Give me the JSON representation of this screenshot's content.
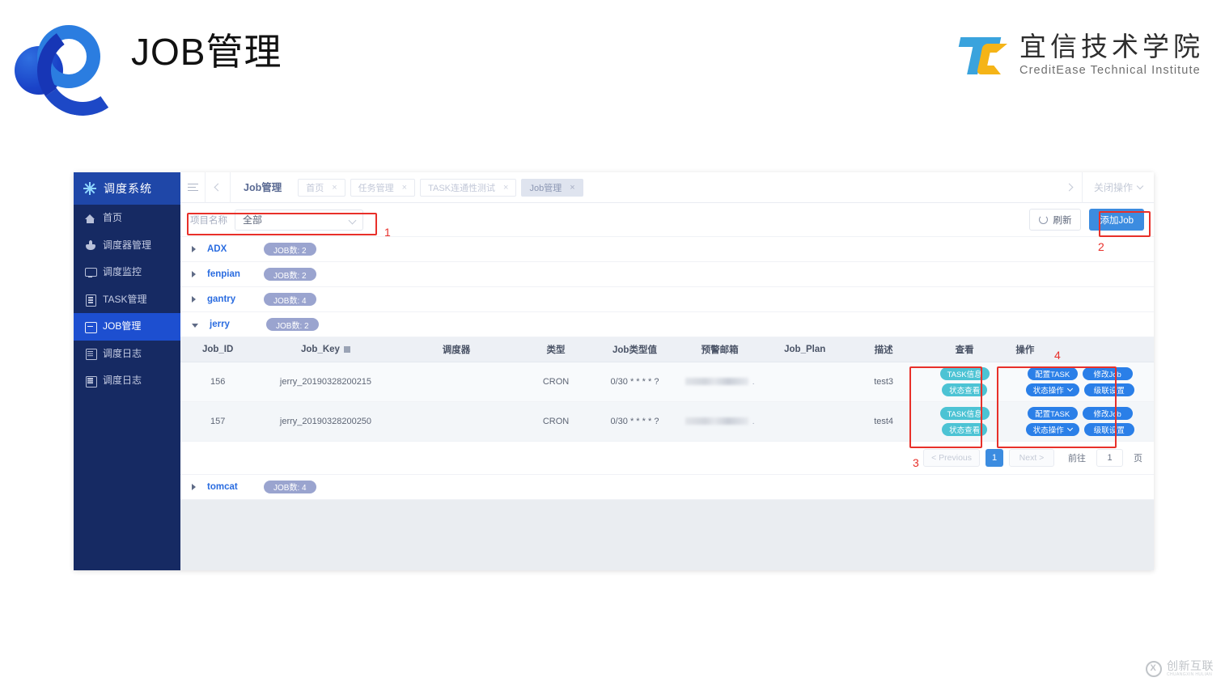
{
  "header": {
    "title": "JOB管理",
    "logo_icon": "overlapping-circles-logo",
    "corp_cn": "宜信技术学院",
    "corp_en": "CreditEase Technical Institute",
    "corp_logo_icon": "tc-monogram-logo"
  },
  "sidebar": {
    "brand": "调度系统",
    "brand_icon": "sun-burst-icon",
    "items": [
      {
        "label": "首页",
        "icon": "home-icon",
        "active": false
      },
      {
        "label": "调度器管理",
        "icon": "scheduler-icon",
        "active": false
      },
      {
        "label": "调度监控",
        "icon": "monitor-icon",
        "active": false
      },
      {
        "label": "TASK管理",
        "icon": "document-icon",
        "active": false
      },
      {
        "label": "JOB管理",
        "icon": "job-grid-icon",
        "active": true
      },
      {
        "label": "调度日志",
        "icon": "log-icon",
        "active": false
      },
      {
        "label": "调度日志",
        "icon": "log-icon",
        "active": false
      }
    ]
  },
  "tabbar": {
    "menu_icon": "hamburger-icon",
    "scroll_left_icon": "chevron-left-icon",
    "scroll_right_icon": "chevron-right-icon",
    "current_title": "Job管理",
    "tabs": [
      {
        "label": "首页",
        "active": false,
        "close": "×"
      },
      {
        "label": "任务管理",
        "active": false,
        "close": "×"
      },
      {
        "label": "TASK连通性测试",
        "active": false,
        "close": "×"
      },
      {
        "label": "Job管理",
        "active": true,
        "close": "×"
      }
    ],
    "close_ops_label": "关闭操作",
    "close_ops_caret": "chevron-down-icon"
  },
  "filterbar": {
    "project_label": "项目名称",
    "project_value": "全部",
    "project_caret": "chevron-down-icon",
    "refresh_label": "刷新",
    "refresh_icon": "refresh-icon",
    "add_job_label": "添加Job"
  },
  "groups": [
    {
      "name": "ADX",
      "badge": "JOB数: 2",
      "expanded": false
    },
    {
      "name": "fenpian",
      "badge": "JOB数: 2",
      "expanded": false
    },
    {
      "name": "gantry",
      "badge": "JOB数: 4",
      "expanded": false
    },
    {
      "name": "jerry",
      "badge": "JOB数: 2",
      "expanded": true
    },
    {
      "name": "tomcat",
      "badge": "JOB数: 4",
      "expanded": false
    }
  ],
  "table": {
    "columns": [
      "Job_ID",
      "Job_Key",
      "调度器",
      "类型",
      "Job类型值",
      "预警邮箱",
      "Job_Plan",
      "描述",
      "查看",
      "操作"
    ],
    "job_key_filter_icon": "filter-icon",
    "rows": [
      {
        "job_id": "156",
        "job_key": "jerry_20190328200215",
        "scheduler": "",
        "type": "CRON",
        "type_value": "0/30 * * * * ?",
        "email": "",
        "email_redacted": true,
        "job_plan": "",
        "description": "test3",
        "view_buttons": [
          "TASK信息",
          "状态查看"
        ],
        "action_buttons": [
          "配置TASK",
          "修改Job",
          "状态操作",
          "级联设置"
        ]
      },
      {
        "job_id": "157",
        "job_key": "jerry_20190328200250",
        "scheduler": "",
        "type": "CRON",
        "type_value": "0/30 * * * * ?",
        "email": "",
        "email_redacted": true,
        "job_plan": "",
        "description": "test4",
        "view_buttons": [
          "TASK信息",
          "状态查看"
        ],
        "action_buttons": [
          "配置TASK",
          "修改Job",
          "状态操作",
          "级联设置"
        ]
      }
    ]
  },
  "pagination": {
    "previous": "< Previous",
    "current_page": "1",
    "next": "Next >",
    "goto_label": "前往",
    "goto_value": "1",
    "page_unit": "页"
  },
  "annotations": [
    {
      "number": "1",
      "target": "project-filter"
    },
    {
      "number": "2",
      "target": "add-job-button"
    },
    {
      "number": "3",
      "target": "view-column"
    },
    {
      "number": "4",
      "target": "action-column"
    }
  ],
  "watermark": {
    "cn": "创新互联",
    "en": "CHUANGXIN HULIAN",
    "icon": "cx-circle-logo"
  },
  "colors": {
    "accent_blue": "#3c8ce0",
    "sidebar_bg": "#162a63",
    "sidebar_active": "#1d4fd0",
    "teal_pill": "#4cc3d4",
    "blue_pill": "#2a7fe8",
    "annotation_red": "#e8302a",
    "badge_purple": "#9aa4cf"
  }
}
